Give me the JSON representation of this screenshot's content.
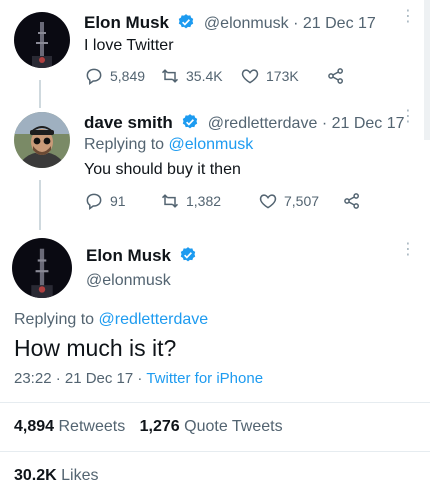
{
  "tweet1": {
    "name": "Elon Musk",
    "handle": "@elonmusk",
    "date": "· 21 Dec 17",
    "text": "I love Twitter",
    "replies": "5,849",
    "retweets": "35.4K",
    "likes": "173K"
  },
  "tweet2": {
    "name": "dave smith",
    "handle": "@redletterdave",
    "date": "· 21 Dec 17",
    "replying_prefix": "Replying to",
    "replying_handle": "@elonmusk",
    "text": "You should buy it then",
    "replies": "91",
    "retweets": "1,382",
    "likes": "7,507"
  },
  "tweet3": {
    "name": "Elon Musk",
    "handle": "@elonmusk",
    "replying_prefix": "Replying to",
    "replying_handle": "@redletterdave",
    "text": "How much is it?",
    "time": "23:22 · 21 Dec 17 ·",
    "source": "Twitter for iPhone",
    "retweets_count": "4,894",
    "retweets_label": "Retweets",
    "quotes_count": "1,276",
    "quotes_label": "Quote Tweets",
    "likes_count": "30.2K",
    "likes_label": "Likes"
  },
  "colors": {
    "accent": "#1d9bf0",
    "text": "#0f1419",
    "muted": "#536471",
    "border": "#e6ecf0"
  },
  "icons": [
    "reply-icon",
    "retweet-icon",
    "like-icon",
    "share-icon",
    "verified-icon",
    "more-icon"
  ]
}
